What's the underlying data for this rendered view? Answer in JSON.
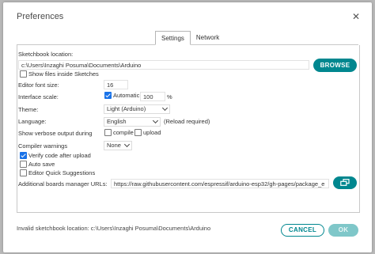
{
  "dialog": {
    "title": "Preferences",
    "tabs": [
      {
        "label": "Settings",
        "active": true
      },
      {
        "label": "Network",
        "active": false
      }
    ]
  },
  "settings": {
    "sketchbook_label": "Sketchbook location:",
    "sketchbook_path": "c:\\Users\\Inzaghi Posuma\\Documents\\Arduino",
    "browse_label": "BROWSE",
    "show_files_label": "Show files inside Sketches",
    "show_files_checked": false,
    "font_size_label": "Editor font size:",
    "font_size_value": "16",
    "scale_label": "Interface scale:",
    "scale_auto_label": "Automatic",
    "scale_auto_checked": true,
    "scale_value": "100",
    "scale_unit": "%",
    "theme_label": "Theme:",
    "theme_value": "Light (Arduino)",
    "language_label": "Language:",
    "language_value": "English",
    "language_note": "(Reload required)",
    "verbose_label": "Show verbose output during",
    "verbose_compile_label": "compile",
    "verbose_compile_checked": false,
    "verbose_upload_label": "upload",
    "verbose_upload_checked": false,
    "warnings_label": "Compiler warnings",
    "warnings_value": "None",
    "verify_label": "Verify code after upload",
    "verify_checked": true,
    "autosave_label": "Auto save",
    "autosave_checked": false,
    "quick_suggest_label": "Editor Quick Suggestions",
    "quick_suggest_checked": false,
    "boards_url_label": "Additional boards manager URLs:",
    "boards_url_value": "https://raw.githubusercontent.com/espressif/arduino-esp32/gh-pages/package_e"
  },
  "footer": {
    "error_text": "Invalid sketchbook location: c:\\Users\\Inzaghi Posuma\\Documents\\Arduino",
    "cancel_label": "CANCEL",
    "ok_label": "OK"
  },
  "colors": {
    "accent": "#00878f",
    "accent_disabled": "#7fc7c9",
    "checkbox_on": "#1a73e8"
  }
}
